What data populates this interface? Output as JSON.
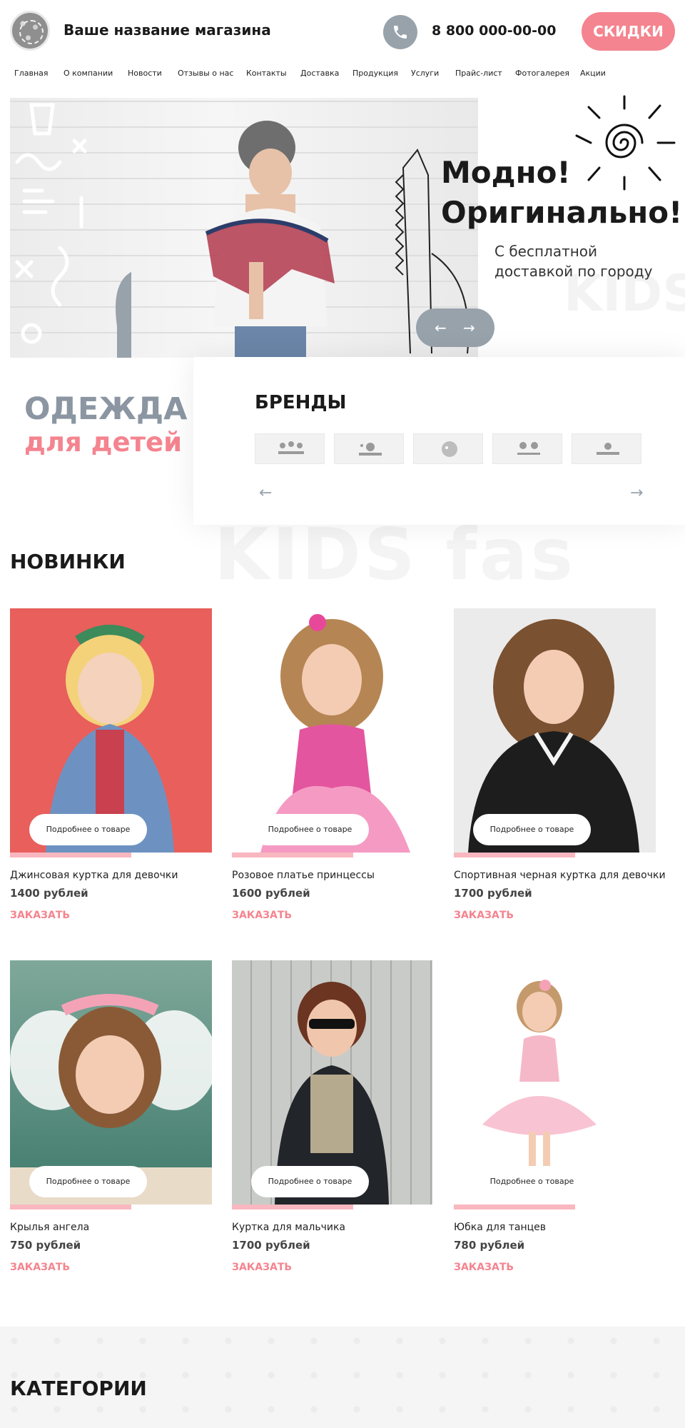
{
  "header": {
    "store_name": "Ваше название магазина",
    "phone": "8 800 000-00-00",
    "sale_label": "СКИДКИ"
  },
  "nav": {
    "items": [
      "Главная",
      "О компании",
      "Новости",
      "Отзывы о нас",
      "Контакты",
      "Доставка",
      "Продукция",
      "Услуги",
      "Прайс-лист",
      "Фотогалерея",
      "Акции"
    ]
  },
  "hero": {
    "title_line1": "Модно!",
    "title_line2": "Оригинально!",
    "subtitle": "С бесплатной доставкой по городу",
    "prev_arrow": "←",
    "next_arrow": "→"
  },
  "brand_block": {
    "headline_top": "ОДЕЖДА",
    "headline_bottom": "для детей",
    "brands_title": "БРЕНДЫ",
    "prev_arrow": "←",
    "next_arrow": "→"
  },
  "new_arrivals": {
    "title": "НОВИНКИ",
    "more_label": "Подробнее о товаре",
    "order_label": "ЗАКАЗАТЬ",
    "products": [
      {
        "name": "Джинсовая куртка для девочки",
        "price": "1400 рублей"
      },
      {
        "name": "Розовое платье принцессы",
        "price": "1600 рублей"
      },
      {
        "name": "Спортивная черная куртка для девочки",
        "price": "1700 рублей"
      },
      {
        "name": "Крылья ангела",
        "price": "750 рублей"
      },
      {
        "name": "Куртка для мальчика",
        "price": "1700 рублей"
      },
      {
        "name": "Юбка для танцев",
        "price": "780 рублей"
      }
    ]
  },
  "categories": {
    "title": "КАТЕГОРИИ"
  },
  "colors": {
    "accent_pink": "#f4848f",
    "grey_blue": "#98a2ab",
    "light_pink": "#f9b7bf"
  }
}
